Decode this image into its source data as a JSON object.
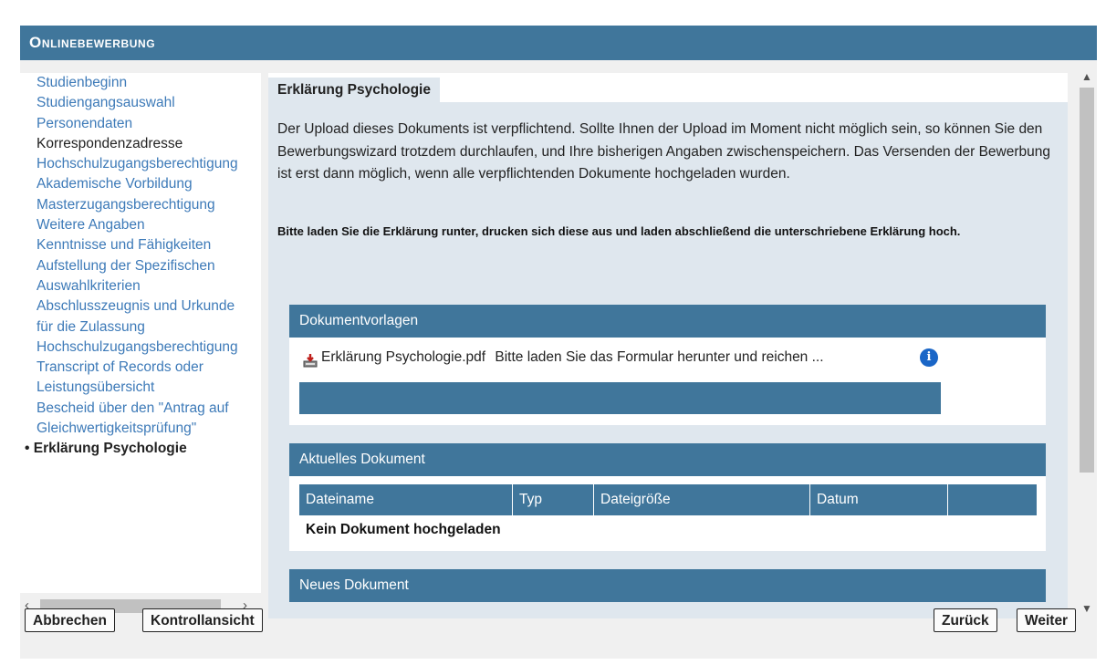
{
  "app": {
    "title": "Onlinebewerbung"
  },
  "nav": {
    "items": [
      {
        "label": "Studienbeginn",
        "state": "link"
      },
      {
        "label": "Studiengangsauswahl",
        "state": "link"
      },
      {
        "label": "Personendaten",
        "state": "link"
      },
      {
        "label": "Korrespondenzadresse",
        "state": "visited"
      },
      {
        "label": "Hochschulzugangsberechtigung",
        "state": "link"
      },
      {
        "label": "Akademische Vorbildung",
        "state": "link"
      },
      {
        "label": "Masterzugangsberechtigung",
        "state": "link"
      },
      {
        "label": "Weitere Angaben",
        "state": "link"
      },
      {
        "label": "Kenntnisse und Fähigkeiten",
        "state": "link"
      },
      {
        "label": "Aufstellung der Spezifischen",
        "state": "link"
      },
      {
        "label": "Auswahlkriterien",
        "state": "link"
      },
      {
        "label": "Abschlusszeugnis und Urkunde",
        "state": "link"
      },
      {
        "label": "für die Zulassung",
        "state": "link"
      },
      {
        "label": "Hochschulzugangsberechtigung",
        "state": "link"
      },
      {
        "label": "Transcript of Records oder",
        "state": "link"
      },
      {
        "label": "Leistungsübersicht",
        "state": "link"
      },
      {
        "label": "Bescheid über den \"Antrag auf",
        "state": "link"
      },
      {
        "label": "Gleichwertigkeitsprüfung\"",
        "state": "link"
      },
      {
        "label": "• Erklärung Psychologie",
        "state": "current"
      }
    ]
  },
  "main": {
    "tab_title": "Erklärung Psychologie",
    "intro": "Der Upload dieses Dokuments ist verpflichtend. Sollte Ihnen der Upload im Moment nicht möglich sein, so können Sie den Bewerbungswizard trotzdem durchlaufen, und Ihre bisherigen Angaben zwischenspeichern. Das Versenden der Bewerbung ist erst dann möglich, wenn alle verpflichtenden Dokumente hochgeladen wurden.",
    "instruction": "Bitte laden Sie die Erklärung runter, drucken sich diese aus und laden abschließend die unterschriebene Erklärung hoch.",
    "templates": {
      "title": "Dokumentvorlagen",
      "file_name": "Erklärung Psychologie.pdf",
      "file_desc": "Bitte laden Sie das Formular herunter und reichen ...",
      "info_glyph": "i"
    },
    "current": {
      "title": "Aktuelles Dokument",
      "columns": [
        "Dateiname",
        "Typ",
        "Dateigröße",
        "Datum",
        ""
      ],
      "empty_text": "Kein Dokument hochgeladen"
    },
    "new": {
      "title": "Neues Dokument"
    }
  },
  "buttons": {
    "cancel": "Abbrechen",
    "review": "Kontrollansicht",
    "back": "Zurück",
    "next": "Weiter"
  },
  "colors": {
    "accent": "#40769b",
    "link": "#3d7ab8",
    "panel": "#dfe7ee"
  }
}
